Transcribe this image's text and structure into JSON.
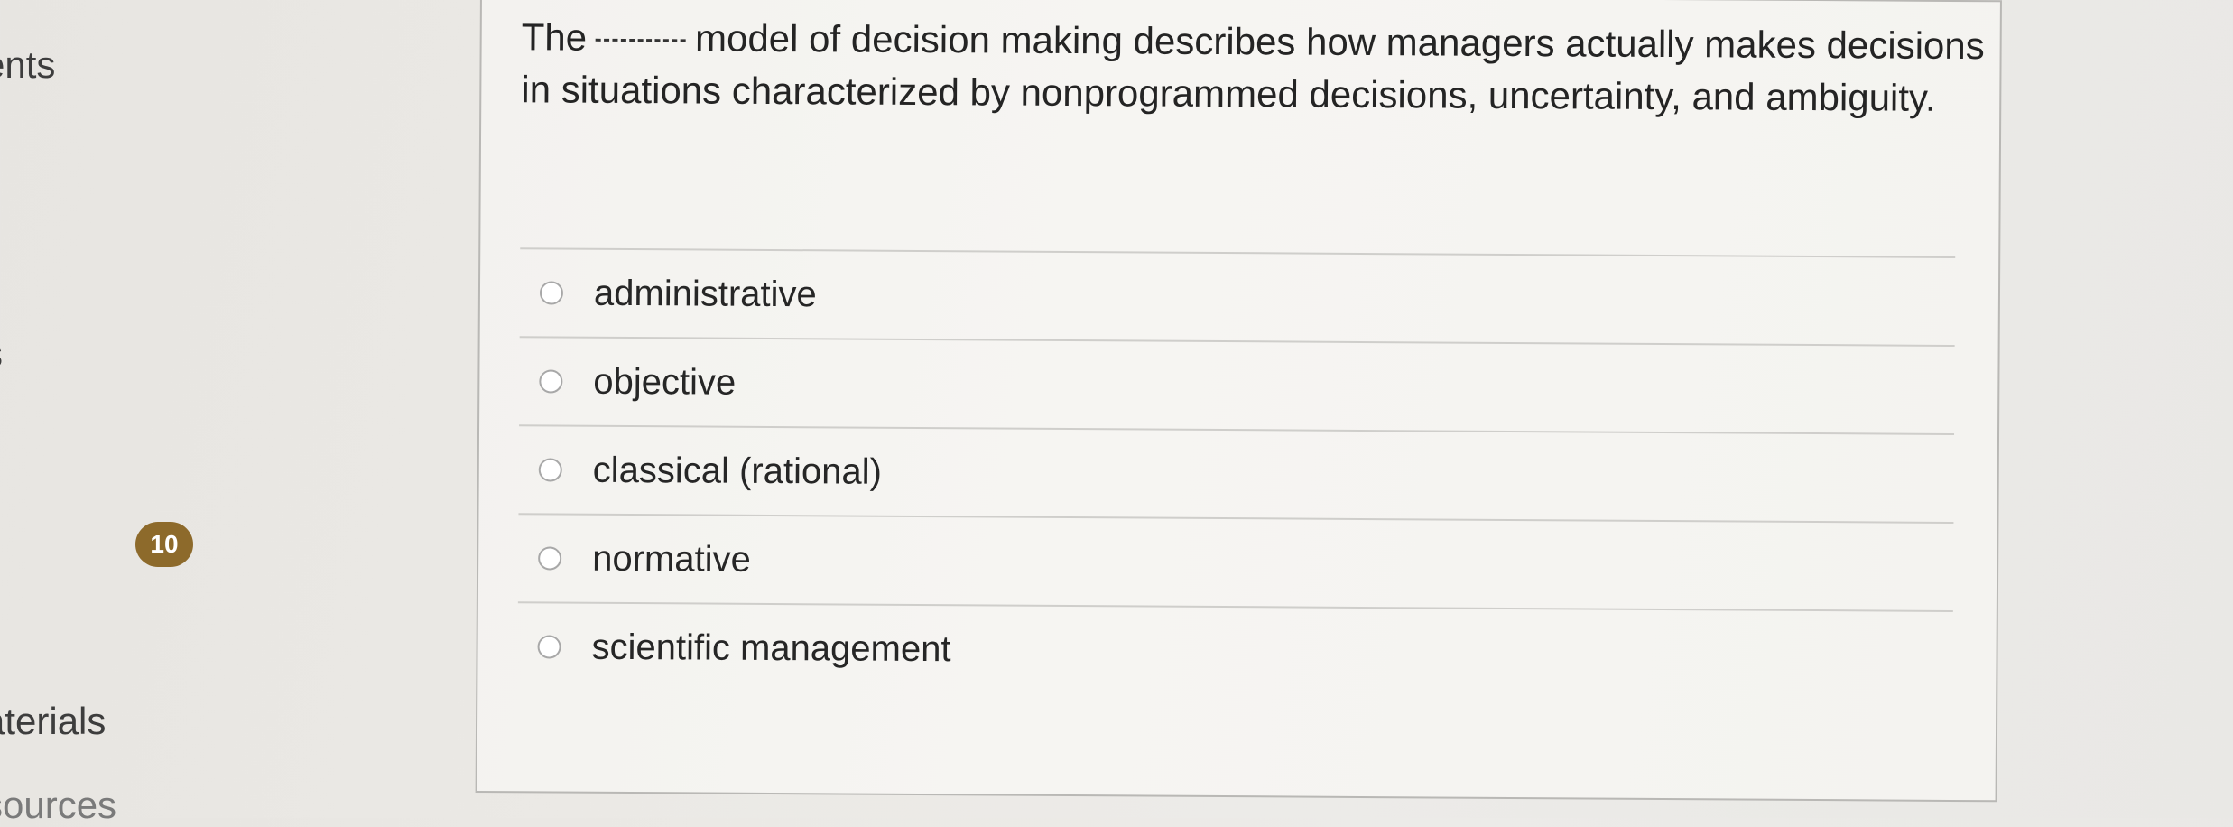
{
  "sidebar": {
    "items": [
      {
        "label": "ents"
      },
      {
        "label": "s"
      },
      {
        "label": "aterials"
      },
      {
        "label": "sources"
      }
    ],
    "badge_count": "10"
  },
  "question": {
    "text_before": "The",
    "blank": "_____",
    "text_after": "model of decision making describes how managers actually makes decisions in situations characterized by nonprogrammed decisions, uncertainty, and ambiguity."
  },
  "options": [
    {
      "label": "administrative",
      "selected": false
    },
    {
      "label": "objective",
      "selected": false
    },
    {
      "label": "classical (rational)",
      "selected": false
    },
    {
      "label": "normative",
      "selected": false
    },
    {
      "label": "scientific management",
      "selected": false
    }
  ]
}
